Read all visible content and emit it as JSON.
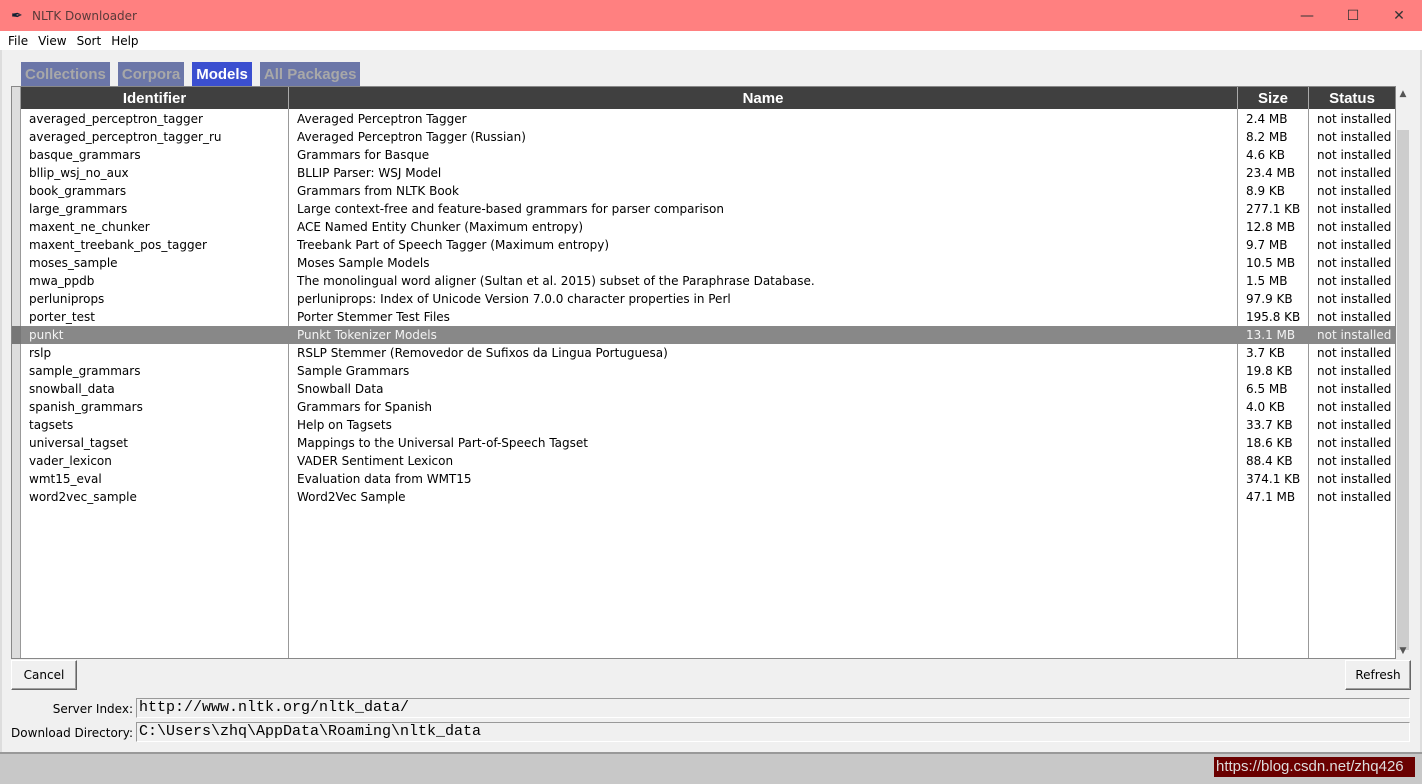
{
  "window": {
    "title": "NLTK Downloader",
    "icon": "feather-icon"
  },
  "menu": [
    "File",
    "View",
    "Sort",
    "Help"
  ],
  "tabs": [
    {
      "label": "Collections",
      "active": false
    },
    {
      "label": "Corpora",
      "active": false
    },
    {
      "label": "Models",
      "active": true
    },
    {
      "label": "All Packages",
      "active": false
    }
  ],
  "table": {
    "columns": [
      "Identifier",
      "Name",
      "Size",
      "Status"
    ],
    "selected_index": 12,
    "rows": [
      [
        "averaged_perceptron_tagger",
        "Averaged Perceptron Tagger",
        "2.4 MB",
        "not installed"
      ],
      [
        "averaged_perceptron_tagger_ru",
        "Averaged Perceptron Tagger (Russian)",
        "8.2 MB",
        "not installed"
      ],
      [
        "basque_grammars",
        "Grammars for Basque",
        "4.6 KB",
        "not installed"
      ],
      [
        "bllip_wsj_no_aux",
        "BLLIP Parser: WSJ Model",
        "23.4 MB",
        "not installed"
      ],
      [
        "book_grammars",
        "Grammars from NLTK Book",
        "8.9 KB",
        "not installed"
      ],
      [
        "large_grammars",
        "Large context-free and feature-based grammars for parser comparison",
        "277.1 KB",
        "not installed"
      ],
      [
        "maxent_ne_chunker",
        "ACE Named Entity Chunker (Maximum entropy)",
        "12.8 MB",
        "not installed"
      ],
      [
        "maxent_treebank_pos_tagger",
        "Treebank Part of Speech Tagger (Maximum entropy)",
        "9.7 MB",
        "not installed"
      ],
      [
        "moses_sample",
        "Moses Sample Models",
        "10.5 MB",
        "not installed"
      ],
      [
        "mwa_ppdb",
        "The monolingual word aligner (Sultan et al. 2015) subset of the Paraphrase Database.",
        "1.5 MB",
        "not installed"
      ],
      [
        "perluniprops",
        "perluniprops: Index of Unicode Version 7.0.0 character properties in Perl",
        "97.9 KB",
        "not installed"
      ],
      [
        "porter_test",
        "Porter Stemmer Test Files",
        "195.8 KB",
        "not installed"
      ],
      [
        "punkt",
        "Punkt Tokenizer Models",
        "13.1 MB",
        "not installed"
      ],
      [
        "rslp",
        "RSLP Stemmer (Removedor de Sufixos da Lingua Portuguesa)",
        "3.7 KB",
        "not installed"
      ],
      [
        "sample_grammars",
        "Sample Grammars",
        "19.8 KB",
        "not installed"
      ],
      [
        "snowball_data",
        "Snowball Data",
        "6.5 MB",
        "not installed"
      ],
      [
        "spanish_grammars",
        "Grammars for Spanish",
        "4.0 KB",
        "not installed"
      ],
      [
        "tagsets",
        "Help on Tagsets",
        "33.7 KB",
        "not installed"
      ],
      [
        "universal_tagset",
        "Mappings to the Universal Part-of-Speech Tagset",
        "18.6 KB",
        "not installed"
      ],
      [
        "vader_lexicon",
        "VADER Sentiment Lexicon",
        "88.4 KB",
        "not installed"
      ],
      [
        "wmt15_eval",
        "Evaluation data from WMT15",
        "374.1 KB",
        "not installed"
      ],
      [
        "word2vec_sample",
        "Word2Vec Sample",
        "47.1 MB",
        "not installed"
      ]
    ]
  },
  "buttons": {
    "cancel": "Cancel",
    "refresh": "Refresh"
  },
  "server_index": {
    "label": "Server Index:",
    "value": "http://www.nltk.org/nltk_data/"
  },
  "download_directory": {
    "label": "Download Directory:",
    "value": "C:\\Users\\zhq\\AppData\\Roaming\\nltk_data"
  },
  "watermark": "https://blog.csdn.net/zhq426",
  "colors": {
    "titlebar": "#ff8080",
    "tab_active": "#3b4fd0",
    "tab_inactive": "#6b76a8",
    "header": "#404040",
    "selected_row": "#888888"
  }
}
